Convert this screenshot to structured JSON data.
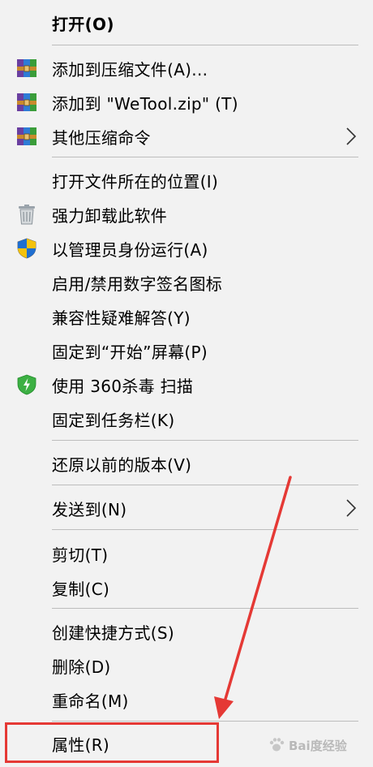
{
  "menu": {
    "open": "打开(O)",
    "add_archive": "添加到压缩文件(A)...",
    "add_zip": "添加到 \"WeTool.zip\" (T)",
    "other_compress": "其他压缩命令",
    "open_location": "打开文件所在的位置(I)",
    "force_uninstall": "强力卸载此软件",
    "run_as_admin": "以管理员身份运行(A)",
    "sig_icon": "启用/禁用数字签名图标",
    "compat": "兼容性疑难解答(Y)",
    "pin_start": "固定到“开始”屏幕(P)",
    "scan_360": "使用 360杀毒 扫描",
    "pin_taskbar": "固定到任务栏(K)",
    "restore_versions": "还原以前的版本(V)",
    "send_to": "发送到(N)",
    "cut": "剪切(T)",
    "copy": "复制(C)",
    "create_shortcut": "创建快捷方式(S)",
    "delete": "删除(D)",
    "rename": "重命名(M)",
    "properties": "属性(R)"
  },
  "icons": {
    "archive": "winrar-archive-icon",
    "trash": "trash-icon",
    "shield": "uac-shield-icon",
    "antivirus": "360-antivirus-icon",
    "chevron": "chevron-right-icon"
  },
  "colors": {
    "highlight": "#e53935",
    "menu_bg": "#f2f2f2",
    "separator": "#bdbdbd"
  },
  "watermark": {
    "text": "Bai度经验"
  }
}
